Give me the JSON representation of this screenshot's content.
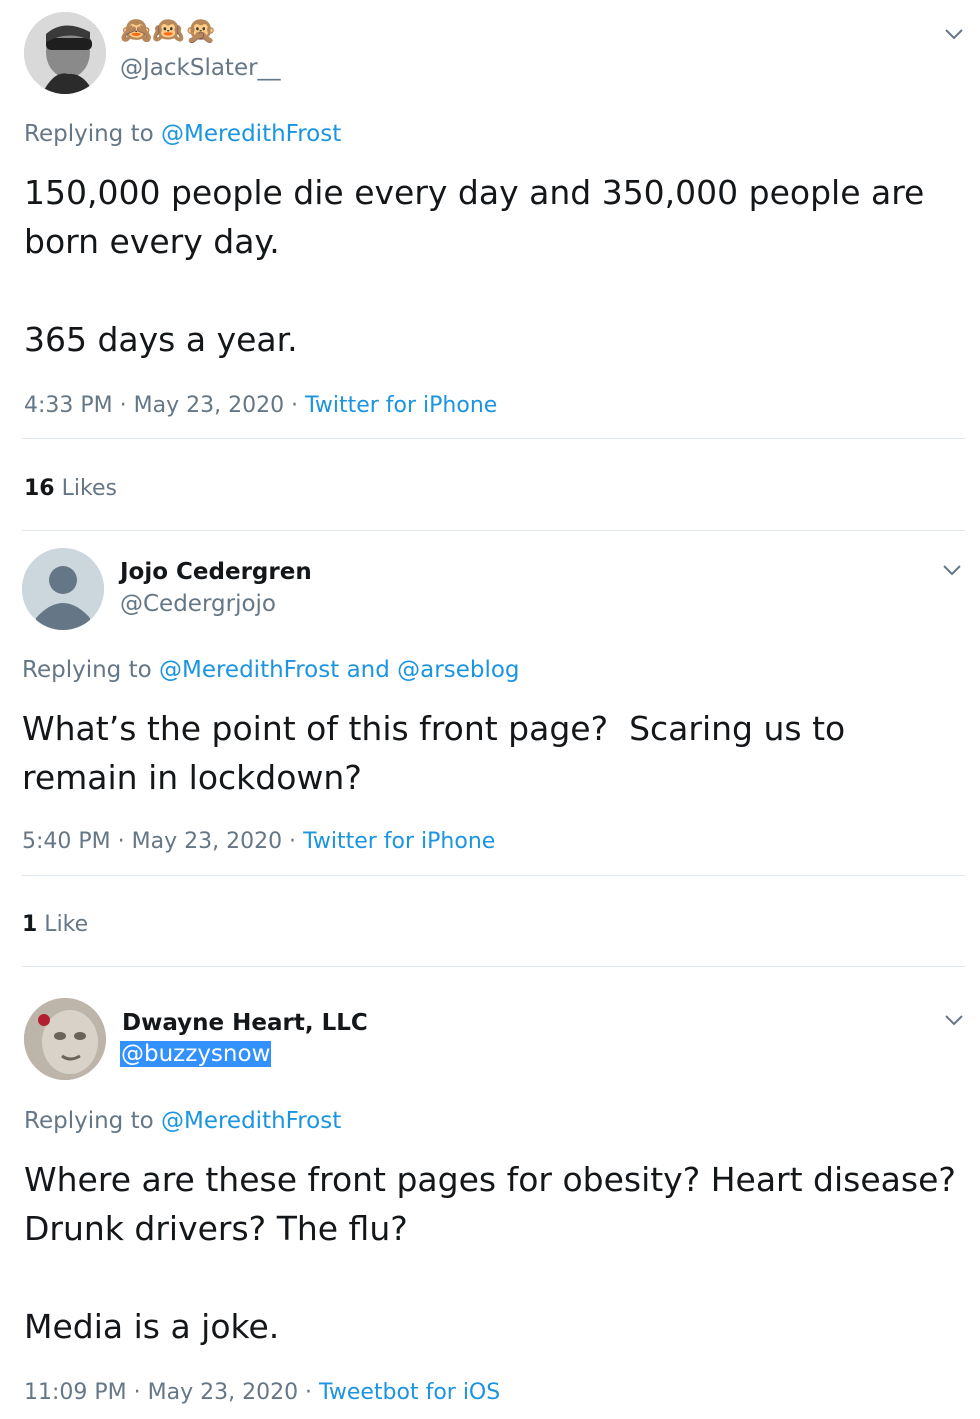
{
  "tweets": [
    {
      "name": "🙈🙉🙊",
      "handle": "@JackSlater__",
      "reply_prefix": "Replying to",
      "reply_users": [
        "@MeredithFrost"
      ],
      "reply_joiner": "",
      "body": "150,000 people die every day and 350,000 people are\nborn every day.\n\n365 days a year.",
      "time": "4:33 PM · May 23, 2020 · ",
      "source": "Twitter for iPhone",
      "likes_count": "16",
      "likes_label": " Likes"
    },
    {
      "name": "Jojo Cedergren",
      "handle": "@Cedergrjojo",
      "reply_prefix": "Replying to",
      "reply_users": [
        "@MeredithFrost",
        "@arseblog"
      ],
      "reply_joiner": "and",
      "body": "What’s the point of this front page?  Scaring us to\nremain in lockdown?",
      "time": "5:40 PM · May 23, 2020 · ",
      "source": "Twitter for iPhone",
      "likes_count": "1",
      "likes_label": " Like"
    },
    {
      "name": "Dwayne Heart, LLC",
      "handle": "@buzzysnow",
      "reply_prefix": "Replying to",
      "reply_users": [
        "@MeredithFrost"
      ],
      "reply_joiner": "",
      "body": "Where are these front pages for obesity? Heart disease?\nDrunk drivers? The flu?\n\nMedia is a joke.",
      "time": "11:09 PM · May 23, 2020 · ",
      "source": "Tweetbot for iOS"
    }
  ],
  "colors": {
    "link": "#1b95e0",
    "secondary": "#657786",
    "primary": "#14171a",
    "divider": "#e1e8ed",
    "selection": "#3390ff"
  },
  "icons": [
    "chevron-down-icon",
    "default-avatar-icon"
  ]
}
